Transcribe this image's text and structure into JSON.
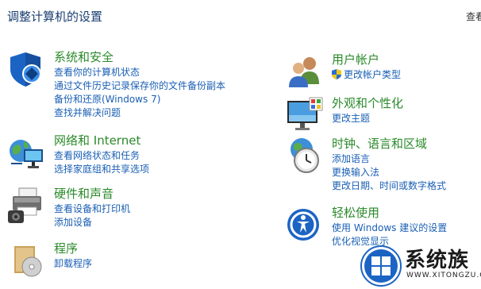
{
  "header": {
    "title": "调整计算机的设置",
    "view_by": "查看"
  },
  "categories": {
    "system": {
      "title": "系统和安全",
      "icon": "security-shield-icon",
      "links": [
        "查看你的计算机状态",
        "通过文件历史记录保存你的文件备份副本",
        "备份和还原(Windows 7)",
        "查找并解决问题"
      ]
    },
    "network": {
      "title": "网络和 Internet",
      "icon": "network-globe-icon",
      "links": [
        "查看网络状态和任务",
        "选择家庭组和共享选项"
      ]
    },
    "hardware": {
      "title": "硬件和声音",
      "icon": "printer-speaker-icon",
      "links": [
        "查看设备和打印机",
        "添加设备"
      ]
    },
    "programs": {
      "title": "程序",
      "icon": "programs-disc-icon",
      "links": [
        "卸载程序"
      ]
    },
    "user": {
      "title": "用户帐户",
      "icon": "user-accounts-icon",
      "links": [
        "更改帐户类型"
      ]
    },
    "appearance": {
      "title": "外观和个性化",
      "icon": "monitor-palette-icon",
      "links": [
        "更改主题"
      ]
    },
    "clock": {
      "title": "时钟、语言和区域",
      "icon": "clock-globe-icon",
      "links": [
        "添加语言",
        "更换输入法",
        "更改日期、时间或数字格式"
      ]
    },
    "ease": {
      "title": "轻松使用",
      "icon": "ease-of-access-icon",
      "links": [
        "使用 Windows 建议的设置",
        "优化视觉显示"
      ]
    }
  },
  "watermark": {
    "brand": "系统族",
    "url": "WWW.XITONGZU.COM"
  },
  "colors": {
    "category_title": "#2a8a2a",
    "link": "#1a5fb4",
    "page_title": "#1a3e72"
  }
}
